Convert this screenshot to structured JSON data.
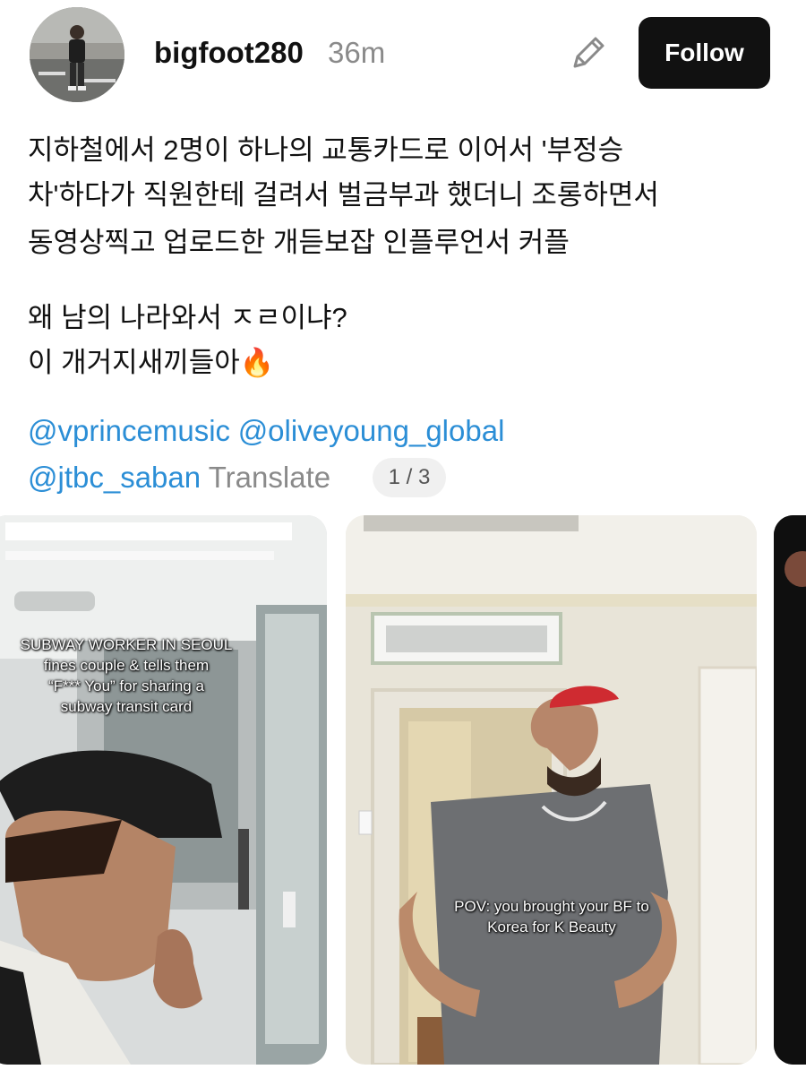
{
  "post": {
    "username": "bigfoot280",
    "time": "36m",
    "follow_label": "Follow",
    "body_lines": [
      "지하철에서 2명이 하나의 교통카드로 이어서 '부정승",
      "차'하다가 직원한테 걸려서 벌금부과 했더니 조롱하면서",
      "동영상찍고 업로드한 개듣보잡 인플루언서 커플"
    ],
    "body_lines_2": [
      "왜 남의 나라와서 ㅈㄹ이냐?",
      "이 개거지새끼들아🔥"
    ],
    "mentions": [
      "@vprincemusic",
      "@oliveyoung_global",
      "@jtbc_saban"
    ],
    "translate_label": "Translate",
    "page_indicator": "1 / 3"
  },
  "media": [
    {
      "caption_lines": [
        "SUBWAY WORKER IN SEOUL",
        "fines couple & tells them",
        "“F*** You” for sharing a",
        "subway transit card"
      ]
    },
    {
      "caption_lines": [
        "POV: you brought your BF to",
        "Korea for K Beauty"
      ]
    }
  ],
  "colors": {
    "mention": "#2b8ed6",
    "follow_bg": "#111111",
    "muted": "#8a8a8a"
  }
}
